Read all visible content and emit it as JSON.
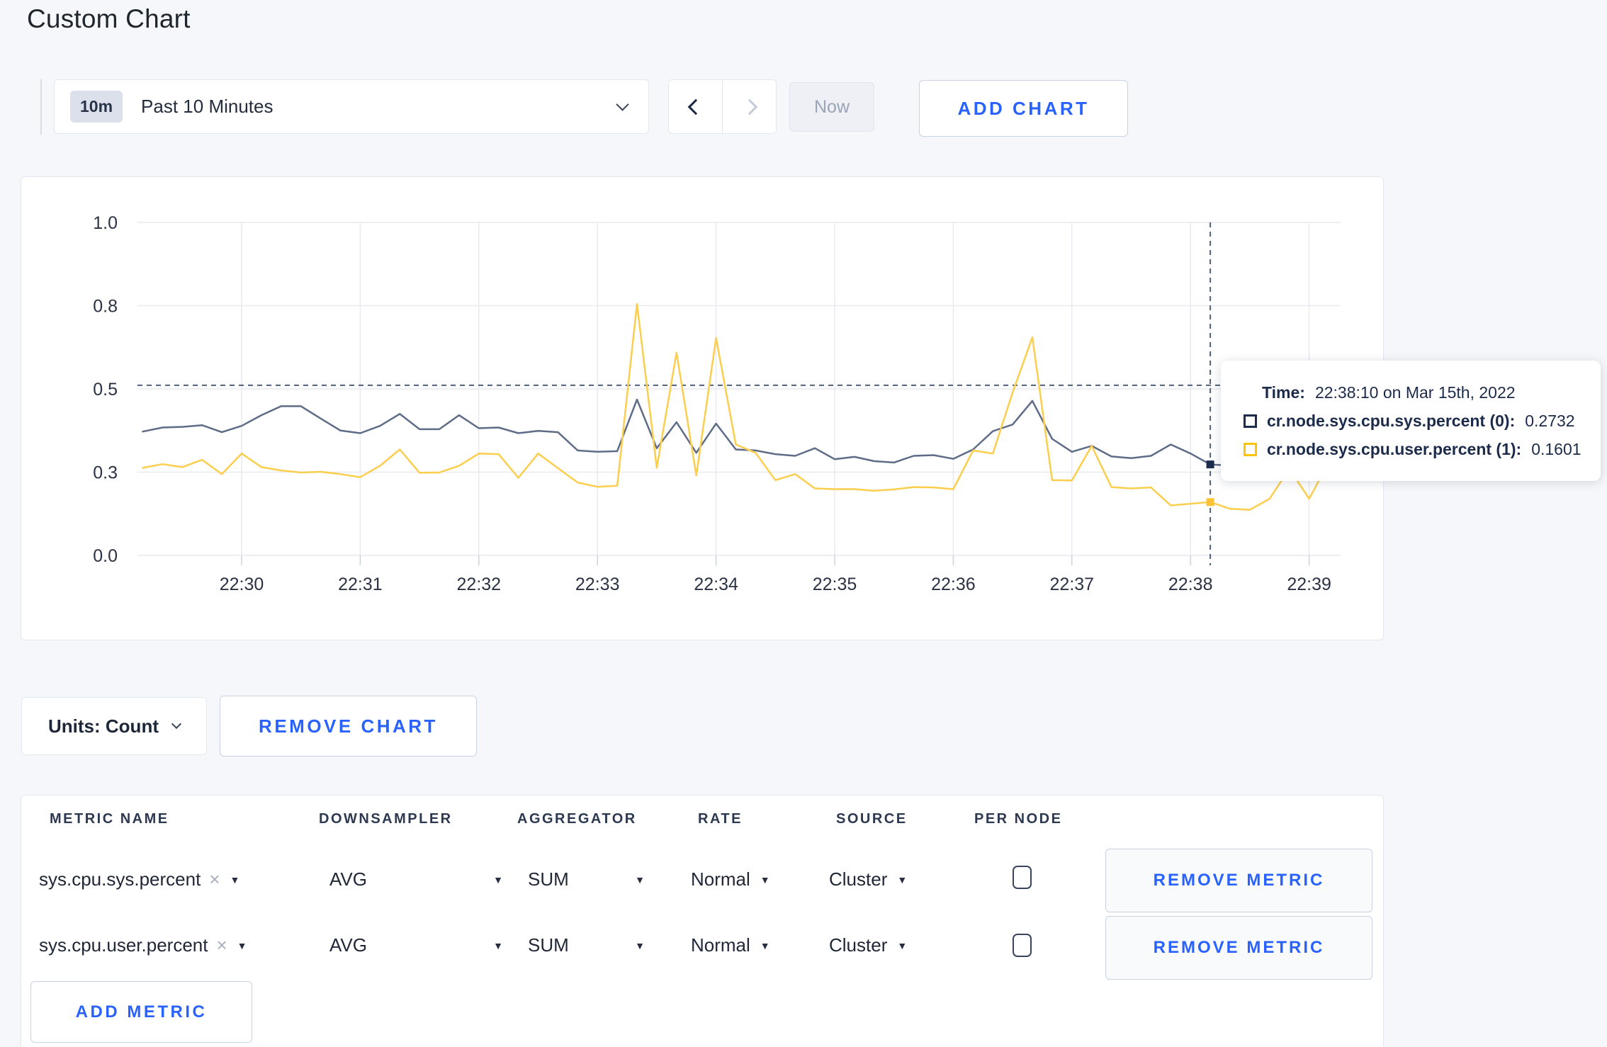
{
  "page": {
    "title": "Custom Chart"
  },
  "toolbar": {
    "range_badge": "10m",
    "range_label": "Past 10 Minutes",
    "now_label": "Now",
    "add_chart_label": "ADD CHART"
  },
  "chart_data": {
    "type": "line",
    "title": "",
    "xlabel": "",
    "ylabel": "",
    "x_start": "22:29:10",
    "x_step_seconds": 10,
    "x_tick_labels": [
      "22:30",
      "22:31",
      "22:32",
      "22:33",
      "22:34",
      "22:35",
      "22:36",
      "22:37",
      "22:38",
      "22:39"
    ],
    "y_tick_labels": [
      "1.0",
      "0.8",
      "0.5",
      "0.3",
      "0.0"
    ],
    "y_tick_values": [
      1.0,
      0.75,
      0.5,
      0.25,
      0.0
    ],
    "ylim": [
      0,
      1
    ],
    "grid": true,
    "legend_position": "tooltip",
    "series": [
      {
        "name": "cr.node.sys.cpu.sys.percent",
        "color": "#5f6c87",
        "values": [
          0.372,
          0.384,
          0.386,
          0.391,
          0.37,
          0.389,
          0.421,
          0.448,
          0.448,
          0.411,
          0.375,
          0.367,
          0.389,
          0.425,
          0.379,
          0.379,
          0.421,
          0.382,
          0.384,
          0.367,
          0.374,
          0.37,
          0.315,
          0.311,
          0.313,
          0.468,
          0.322,
          0.4,
          0.308,
          0.396,
          0.318,
          0.315,
          0.304,
          0.299,
          0.322,
          0.289,
          0.296,
          0.283,
          0.279,
          0.299,
          0.301,
          0.29,
          0.318,
          0.373,
          0.393,
          0.464,
          0.35,
          0.311,
          0.329,
          0.297,
          0.292,
          0.299,
          0.333,
          0.306,
          0.2732,
          0.27,
          0.285,
          0.295,
          0.3,
          0.295,
          0.3,
          0.3
        ]
      },
      {
        "name": "cr.node.sys.cpu.user.percent",
        "color": "#fbce4d",
        "values": [
          0.263,
          0.274,
          0.265,
          0.287,
          0.244,
          0.306,
          0.265,
          0.255,
          0.249,
          0.251,
          0.244,
          0.235,
          0.269,
          0.318,
          0.248,
          0.249,
          0.269,
          0.306,
          0.304,
          0.233,
          0.306,
          0.262,
          0.219,
          0.206,
          0.209,
          0.755,
          0.263,
          0.609,
          0.24,
          0.653,
          0.333,
          0.308,
          0.226,
          0.244,
          0.201,
          0.199,
          0.199,
          0.194,
          0.198,
          0.205,
          0.204,
          0.199,
          0.315,
          0.306,
          0.489,
          0.655,
          0.226,
          0.225,
          0.329,
          0.205,
          0.201,
          0.204,
          0.15,
          0.155,
          0.1601,
          0.14,
          0.137,
          0.17,
          0.26,
          0.17,
          0.28,
          0.25
        ]
      }
    ],
    "crosshair": {
      "x_index": 54,
      "x_time": "22:38:10",
      "hline_value": 0.511,
      "marker_values": [
        0.2732,
        0.1601
      ],
      "marker_colors": [
        "#1d2c4c",
        "#fdc233"
      ],
      "line_color": "#4f6079"
    }
  },
  "tooltip": {
    "time_label": "Time:",
    "time_value": "22:38:10 on Mar 15th, 2022",
    "rows": [
      {
        "label": "cr.node.sys.cpu.sys.percent (0):",
        "value": "0.2732",
        "color": "#1d2c4c"
      },
      {
        "label": "cr.node.sys.cpu.user.percent (1):",
        "value": "0.1601",
        "color": "#ffc400"
      }
    ]
  },
  "units": {
    "label": "Units: Count",
    "remove_chart_label": "REMOVE CHART"
  },
  "metrics_table": {
    "columns": [
      "METRIC NAME",
      "DOWNSAMPLER",
      "AGGREGATOR",
      "RATE",
      "SOURCE",
      "PER NODE"
    ],
    "rows": [
      {
        "metric": "sys.cpu.sys.percent",
        "remove_icon": "×",
        "downsampler": "AVG",
        "aggregator": "SUM",
        "rate": "Normal",
        "source": "Cluster",
        "per_node_checked": false
      },
      {
        "metric": "sys.cpu.user.percent",
        "remove_icon": "×",
        "downsampler": "AVG",
        "aggregator": "SUM",
        "rate": "Normal",
        "source": "Cluster",
        "per_node_checked": false
      }
    ],
    "remove_metric_label": "REMOVE METRIC",
    "add_metric_label": "ADD METRIC"
  },
  "colors": {
    "accent_blue": "#2962ff",
    "page_bg": "#f6f7fa",
    "grid_line": "#e8eaf0",
    "axis_text": "#2a3344",
    "series_sys": "#5f6c87",
    "series_user": "#fbce4d"
  }
}
